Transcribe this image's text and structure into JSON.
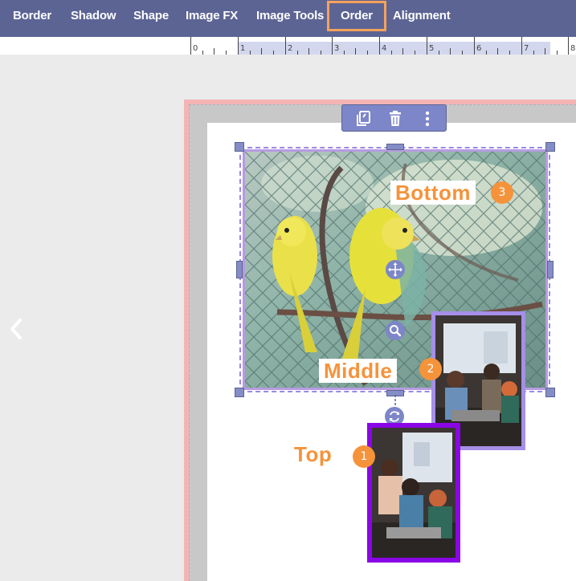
{
  "toolbar": {
    "tabs": [
      {
        "label": "Border"
      },
      {
        "label": "Shadow"
      },
      {
        "label": "Shape"
      },
      {
        "label": "Image FX"
      },
      {
        "label": "Image Tools"
      },
      {
        "label": "Order",
        "active": true
      },
      {
        "label": "Alignment"
      }
    ],
    "active_color": "#f5a25a",
    "background": "#5c6494"
  },
  "ruler": {
    "labels": [
      "0",
      "1",
      "2",
      "3",
      "4",
      "5",
      "6",
      "7",
      "8"
    ]
  },
  "image_tools": {
    "icons": [
      "duplicate-icon",
      "trash-icon",
      "more-vertical-icon"
    ]
  },
  "selection": {
    "move_icon": "move-icon",
    "zoom_icon": "zoom-icon",
    "rotate_icon": "rotate-icon"
  },
  "annotations": {
    "bottom": {
      "label": "Bottom",
      "number": "3"
    },
    "middle": {
      "label": "Middle",
      "number": "2"
    },
    "top": {
      "label": "Top",
      "number": "1"
    },
    "color": "#f5933b"
  },
  "colors": {
    "page_frame": "#f4b4b4",
    "selection": "#9a8ae6",
    "top_border": "#8a06e6",
    "middle_border": "#a58fe8"
  }
}
